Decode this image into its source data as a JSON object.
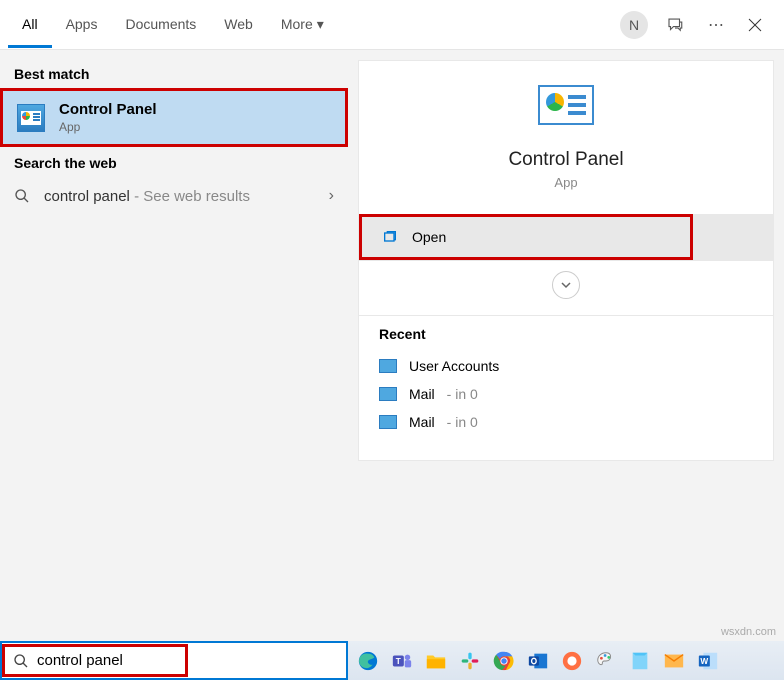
{
  "header": {
    "tabs": [
      "All",
      "Apps",
      "Documents",
      "Web",
      "More"
    ],
    "avatar_initial": "N"
  },
  "left": {
    "best_match_label": "Best match",
    "result": {
      "title": "Control Panel",
      "subtitle": "App"
    },
    "web_label": "Search the web",
    "web_query": "control panel",
    "web_suffix": " - See web results"
  },
  "preview": {
    "title": "Control Panel",
    "subtitle": "App",
    "open_label": "Open",
    "recent_label": "Recent",
    "recent": [
      {
        "label": "User Accounts",
        "suffix": ""
      },
      {
        "label": "Mail",
        "suffix": " - in 0"
      },
      {
        "label": "Mail",
        "suffix": " - in 0"
      }
    ]
  },
  "searchbar": {
    "value": "control panel"
  },
  "watermark": "wsxdn.com"
}
